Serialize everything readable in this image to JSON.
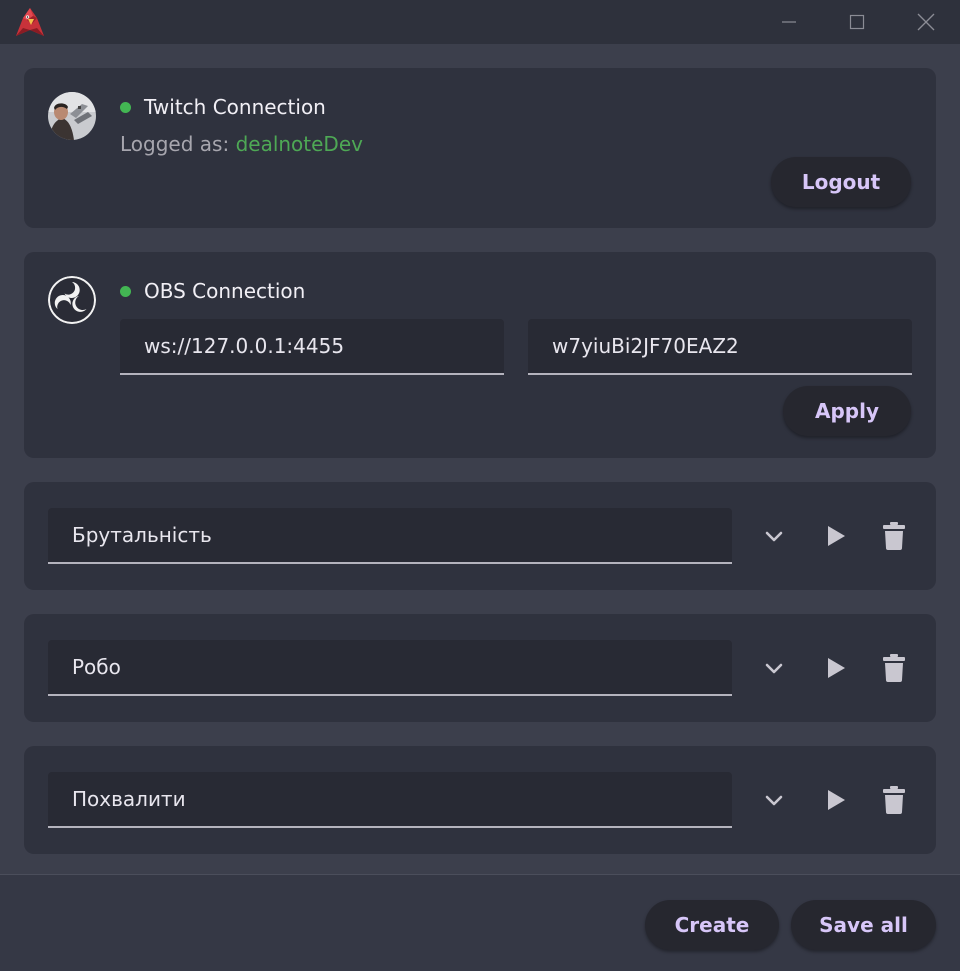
{
  "window": {
    "controls": {
      "minimize_icon": "minimize-icon",
      "maximize_icon": "maximize-icon",
      "close_icon": "close-icon"
    }
  },
  "twitch": {
    "title": "Twitch Connection",
    "status_color": "#43b653",
    "logged_label": "Logged as:",
    "username": "dealnoteDev",
    "logout_label": "Logout"
  },
  "obs": {
    "title": "OBS Connection",
    "status_color": "#43b653",
    "address": "ws://127.0.0.1:4455",
    "password": "w7yiuBi2JF70EAZ2",
    "apply_label": "Apply"
  },
  "presets": [
    {
      "name": "Брутальність"
    },
    {
      "name": "Робо"
    },
    {
      "name": "Похвалити"
    }
  ],
  "footer": {
    "create_label": "Create",
    "save_all_label": "Save all"
  },
  "colors": {
    "accent_text": "#d7c6f8",
    "username_green": "#4ea855",
    "card_bg": "#2f323e",
    "page_bg": "#3c3f4c"
  }
}
